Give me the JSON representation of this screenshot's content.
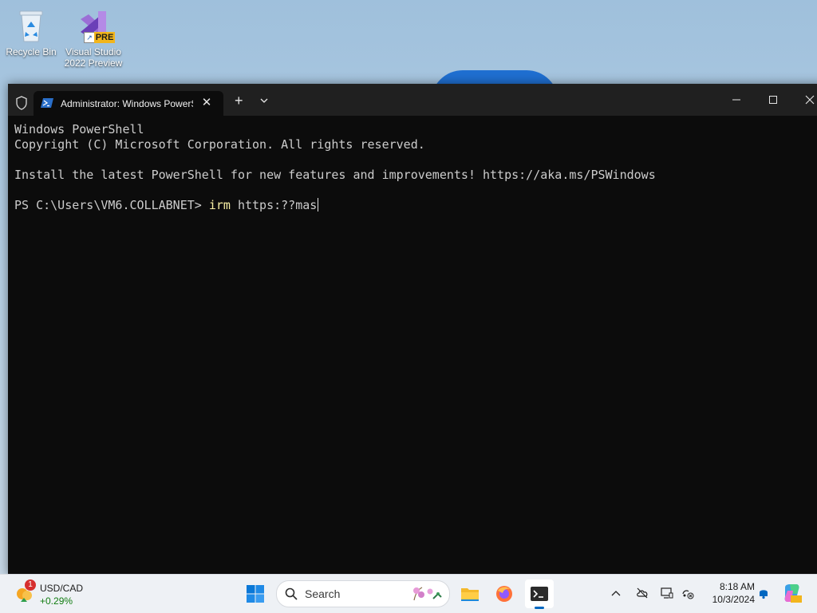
{
  "desktop": {
    "icons": [
      {
        "label": "Recycle Bin"
      },
      {
        "label_line1": "Visual Studio",
        "label_line2": "2022 Preview",
        "badge": "PRE"
      }
    ]
  },
  "window": {
    "tab_title": "Administrator: Windows PowerShell",
    "tab_close": "✕",
    "new_tab": "+",
    "buttons": [
      "minimize",
      "maximize",
      "close"
    ]
  },
  "console": {
    "lines": [
      "Windows PowerShell",
      "Copyright (C) Microsoft Corporation. All rights reserved.",
      "",
      "Install the latest PowerShell for new features and improvements! https://aka.ms/PSWindows",
      ""
    ],
    "prompt": "PS C:\\Users\\VM6.COLLABNET> ",
    "command": "irm",
    "argument": " https:??mas"
  },
  "taskbar": {
    "widget": {
      "badge": "1",
      "name": "USD/CAD",
      "change": "+0.29%"
    },
    "search_label": "Search",
    "apps": [
      "file-explorer",
      "firefox",
      "terminal"
    ],
    "clock": {
      "time": "8:18 AM",
      "date": "10/3/2024"
    }
  },
  "colors": {
    "terminal_bg": "#0c0c0c",
    "titlebar_bg": "#202020",
    "command_color": "#f9f1a5",
    "accent": "#0067c0"
  }
}
